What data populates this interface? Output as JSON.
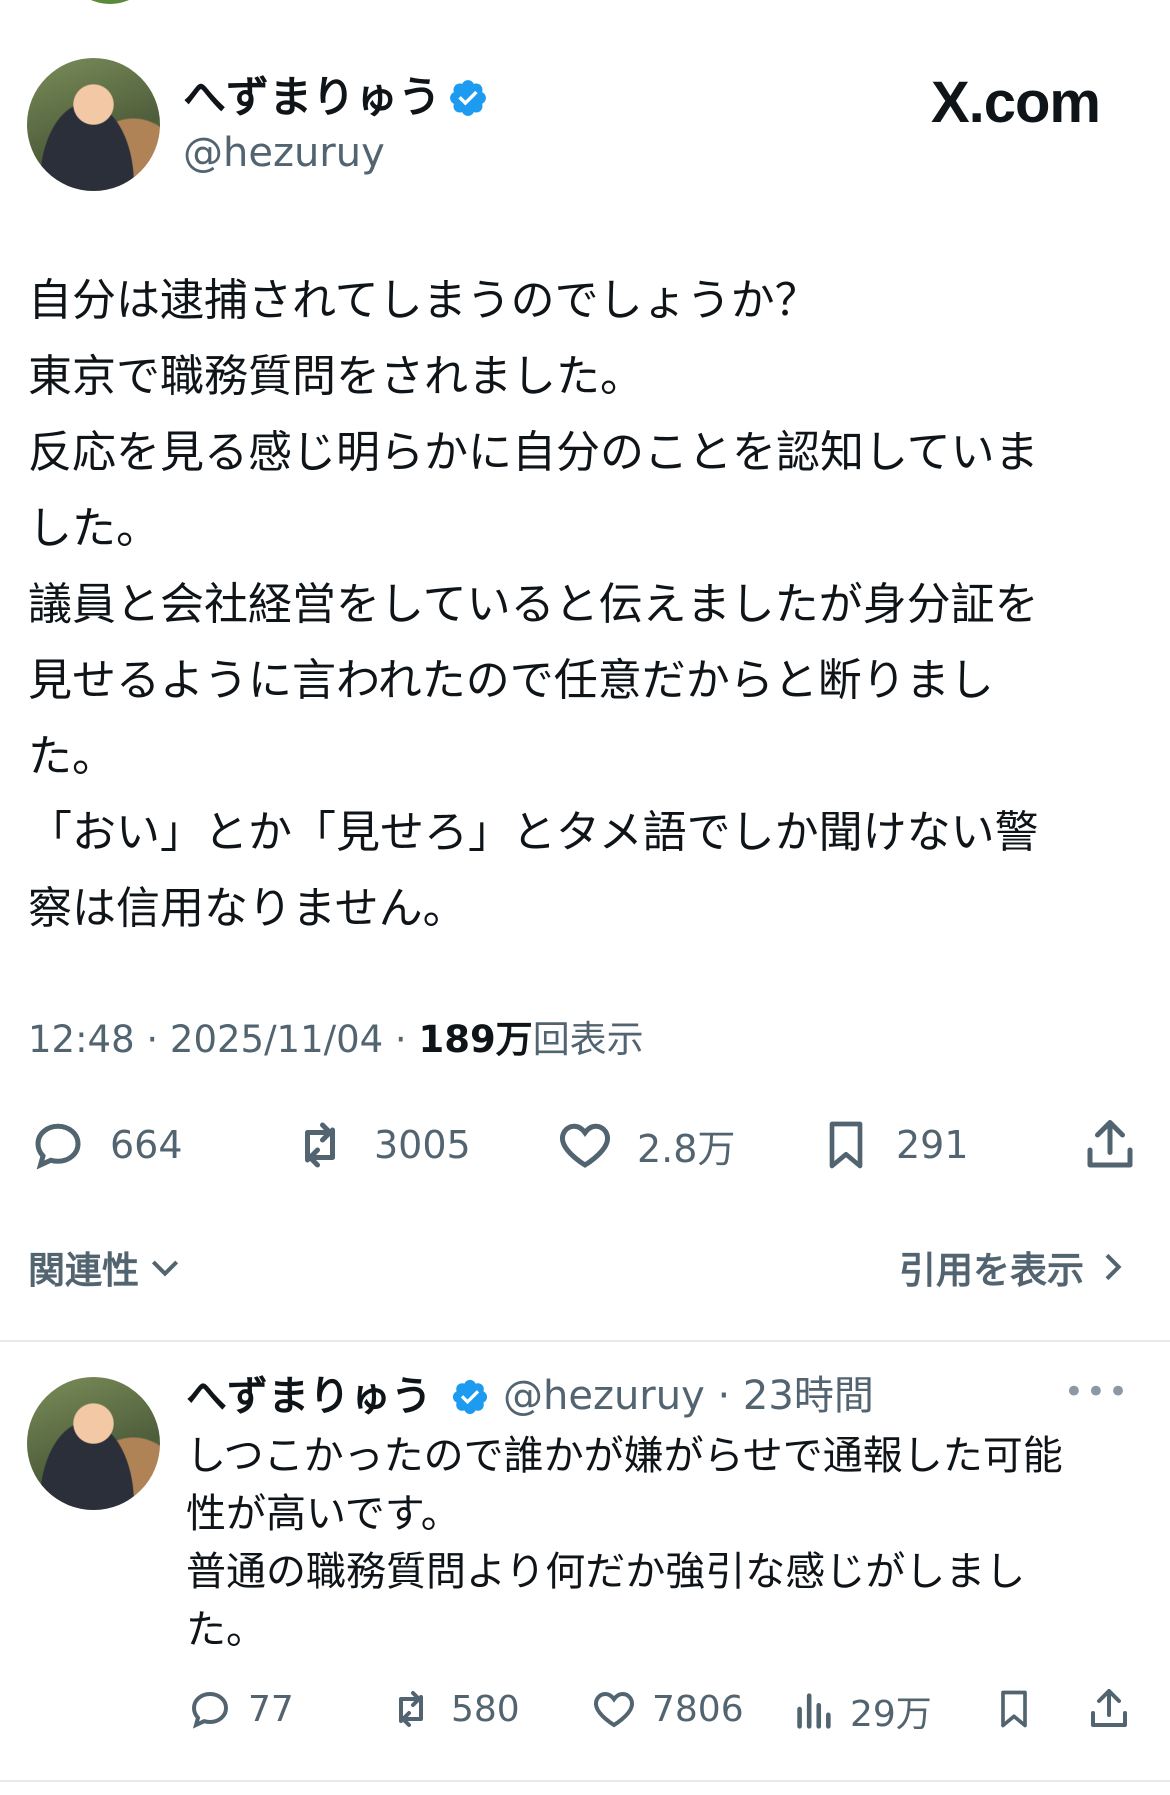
{
  "author": {
    "name": "へずまりゅう",
    "handle": "@hezuruy",
    "verified_color": "#1d9bf0"
  },
  "site_label": "X.com",
  "post": {
    "lines": [
      "自分は逮捕されてしまうのでしょうか？",
      "東京で職務質問をされました。",
      "反応を見る感じ明らかに自分のことを認知していま",
      "した。",
      "議員と会社経営をしていると伝えましたが身分証を",
      "見せるように言われたので任意だからと断りまし",
      "た。",
      "「おい」とか「見せろ」とタメ語でしか聞けない警",
      "察は信用なりません。"
    ],
    "time_date": "12:48 · 2025/11/04 · ",
    "views_count": "189万",
    "views_label": "回表示",
    "replies": "664",
    "reposts": "3005",
    "likes": "2.8万",
    "bookmarks": "291",
    "relevance_label": "関連性",
    "quotes_label": "引用を表示"
  },
  "reply": {
    "name": "へずまりゅう",
    "handle_time": "@hezuruy · 23時間",
    "lines": [
      "しつこかったので誰かが嫌がらせで通報した可能",
      "性が高いです。",
      "普通の職務質問より何だか強引な感じがしまし",
      "た。"
    ],
    "replies": "77",
    "reposts": "580",
    "likes": "7806",
    "views": "29万"
  },
  "icons": [
    "verified-badge-icon",
    "reply-icon",
    "repost-icon",
    "like-icon",
    "bookmark-icon",
    "share-icon",
    "chevron-down-icon",
    "chevron-right-icon",
    "more-icon",
    "analytics-icon"
  ]
}
